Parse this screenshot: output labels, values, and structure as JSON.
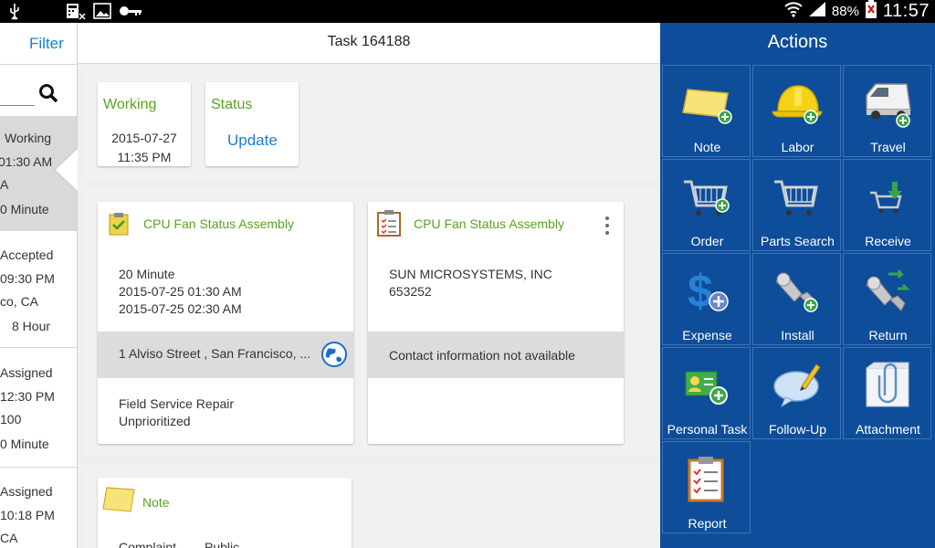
{
  "status_bar": {
    "battery": "88%",
    "time": "11:57"
  },
  "left_pane": {
    "filter_label": "Filter",
    "items": [
      {
        "lines": [
          "Working",
          "01:30 AM",
          "A",
          "0 Minute"
        ]
      },
      {
        "lines": [
          "Accepted",
          "09:30 PM",
          "co, CA",
          "8 Hour"
        ]
      },
      {
        "lines": [
          "Assigned",
          "12:30 PM",
          "100",
          "0 Minute"
        ]
      },
      {
        "lines": [
          "Assigned",
          "10:18 PM",
          "CA"
        ]
      }
    ]
  },
  "center": {
    "title": "Task 164188",
    "working_card": {
      "title": "Working",
      "date": "2015-07-27",
      "time": "11:35 PM"
    },
    "status_card": {
      "title": "Status",
      "action": "Update"
    },
    "assembly_card_1": {
      "title": "CPU Fan Status Assembly",
      "duration": "20 Minute",
      "start": "2015-07-25 01:30 AM",
      "end": "2015-07-25 02:30 AM",
      "address": "1 Alviso Street , San Francisco, ...",
      "type": "Field Service Repair",
      "priority": "Unprioritized"
    },
    "assembly_card_2": {
      "title": "CPU Fan Status Assembly",
      "company": "SUN MICROSYSTEMS, INC",
      "number": "653252",
      "contact": "Contact information not available"
    },
    "note_card": {
      "title": "Note",
      "field1": "Complaint",
      "field2": "Public"
    }
  },
  "actions": {
    "title": "Actions",
    "tiles": [
      {
        "label": "Note",
        "icon": "note-icon"
      },
      {
        "label": "Labor",
        "icon": "hard-hat-icon"
      },
      {
        "label": "Travel",
        "icon": "van-icon"
      },
      {
        "label": "Order",
        "icon": "cart-add-icon"
      },
      {
        "label": "Parts Search",
        "icon": "cart-icon"
      },
      {
        "label": "Receive",
        "icon": "cart-receive-icon"
      },
      {
        "label": "Expense",
        "icon": "dollar-icon"
      },
      {
        "label": "Install",
        "icon": "bolt-add-icon"
      },
      {
        "label": "Return",
        "icon": "bolt-return-icon"
      },
      {
        "label": "Personal Task",
        "icon": "personal-task-icon"
      },
      {
        "label": "Follow-Up",
        "icon": "speech-bubble-icon"
      },
      {
        "label": "Attachment",
        "icon": "paperclip-icon"
      },
      {
        "label": "Report",
        "icon": "clipboard-icon"
      }
    ]
  },
  "colors": {
    "accent_green": "#5aa222",
    "link_blue": "#1a7ed1",
    "actions_bg": "#0e4d9a"
  }
}
